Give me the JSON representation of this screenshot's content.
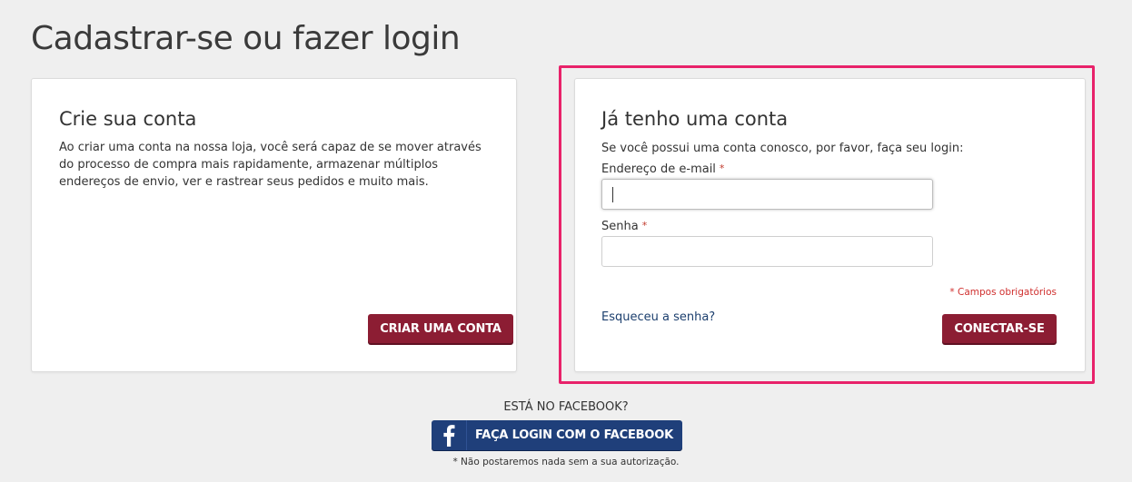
{
  "page": {
    "title": "Cadastrar-se ou fazer login"
  },
  "register": {
    "heading": "Crie sua conta",
    "description": "Ao criar uma conta na nossa loja, você será capaz de se mover através do processo de compra mais rapidamente, armazenar múltiplos endereços de envio, ver e rastrear seus pedidos e muito mais.",
    "button_label": "CRIAR UMA CONTA"
  },
  "login": {
    "heading": "Já tenho uma conta",
    "intro": "Se você possui uma conta conosco, por favor, faça seu login:",
    "email_label": "Endereço de e-mail",
    "email_value": "",
    "password_label": "Senha",
    "password_value": "",
    "required_marker": "*",
    "required_note": "* Campos obrigatórios",
    "forgot_link": "Esqueceu a senha?",
    "button_label": "CONECTAR-SE"
  },
  "facebook": {
    "question": "ESTÁ NO FACEBOOK?",
    "button_label": "FAÇA LOGIN COM O FACEBOOK",
    "icon": "facebook-f-icon",
    "note": "* Não postaremos nada sem a sua autorização."
  },
  "colors": {
    "primary_button": "#8c1d33",
    "facebook_button": "#1f3f7a",
    "highlight_border": "#e8226a",
    "required": "#d0302f",
    "link": "#1c3f6e",
    "background": "#efefef"
  }
}
